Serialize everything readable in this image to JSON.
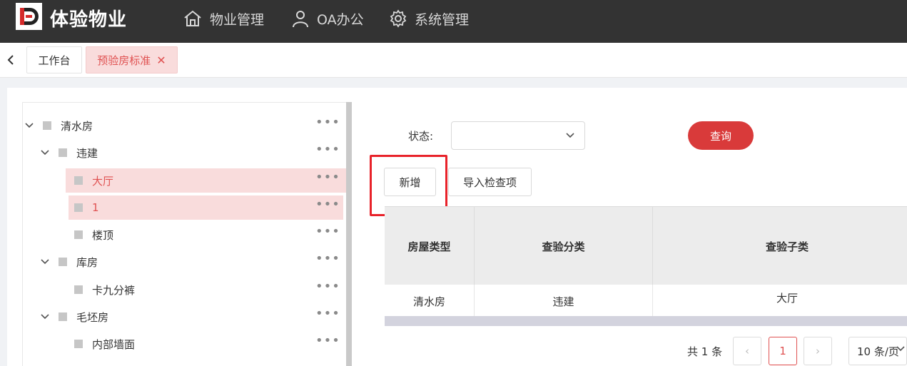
{
  "header": {
    "brand": "体验物业",
    "nav": [
      {
        "label": "物业管理",
        "icon": "home-icon"
      },
      {
        "label": "OA办公",
        "icon": "user-icon"
      },
      {
        "label": "系统管理",
        "icon": "gear-icon"
      }
    ]
  },
  "tabs": {
    "home": "工作台",
    "active": "预验房标准",
    "close_glyph": "✕"
  },
  "tree": {
    "more_glyph": "•••",
    "nodes": [
      {
        "label": "清水房",
        "expanded": true
      },
      {
        "label": "违建",
        "expanded": true
      },
      {
        "label": "大厅",
        "selected": true
      },
      {
        "label": "1",
        "selected": true
      },
      {
        "label": "楼顶"
      },
      {
        "label": "库房",
        "expanded": true
      },
      {
        "label": "卡九分裤"
      },
      {
        "label": "毛坯房",
        "expanded": true
      },
      {
        "label": "内部墙面"
      }
    ]
  },
  "filter": {
    "status_label": "状态:",
    "status_value": "",
    "query_button": "查询"
  },
  "toolbar": {
    "add_button": "新增",
    "import_button": "导入检查项"
  },
  "table": {
    "columns": [
      "房屋类型",
      "查验分类",
      "查验子类"
    ],
    "rows": [
      [
        "清水房",
        "违建",
        "大厅"
      ]
    ]
  },
  "pagination": {
    "total": "共 1 条",
    "prev": "‹",
    "current": "1",
    "next": "›",
    "page_size": "10 条/页"
  },
  "colors": {
    "accent": "#d93a3a",
    "header_bg": "#333333",
    "selected_bg": "#f9dcdc",
    "highlight_box": "#e8222a"
  }
}
